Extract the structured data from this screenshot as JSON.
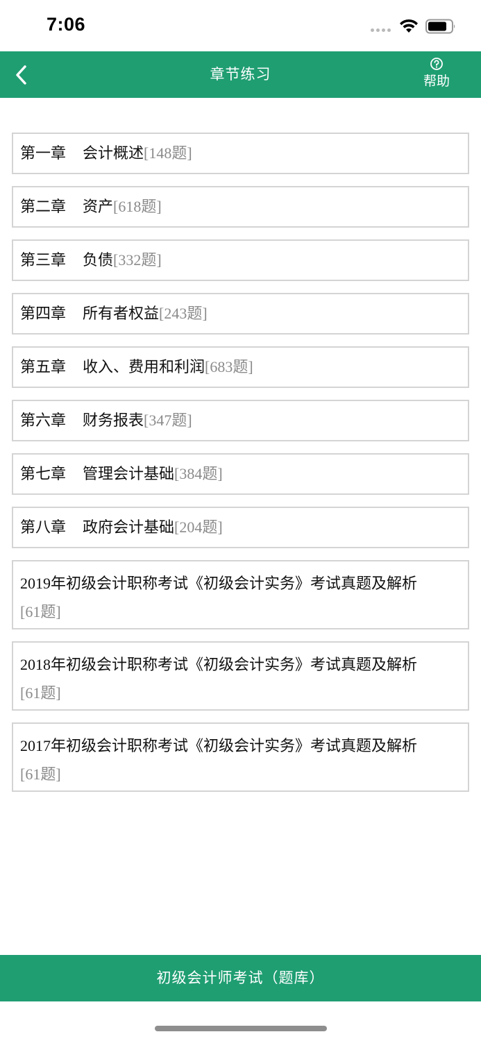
{
  "status": {
    "time": "7:06"
  },
  "header": {
    "title": "章节练习",
    "help_label": "帮助"
  },
  "chapters": [
    {
      "num": "第一章",
      "name": "会计概述",
      "count": "[148题]"
    },
    {
      "num": "第二章",
      "name": "资产",
      "count": "[618题]"
    },
    {
      "num": "第三章",
      "name": "负债",
      "count": "[332题]"
    },
    {
      "num": "第四章",
      "name": "所有者权益",
      "count": "[243题]"
    },
    {
      "num": "第五章",
      "name": "收入、费用和利润",
      "count": "[683题]"
    },
    {
      "num": "第六章",
      "name": "财务报表",
      "count": "[347题]"
    },
    {
      "num": "第七章",
      "name": "管理会计基础",
      "count": "[384题]"
    },
    {
      "num": "第八章",
      "name": "政府会计基础",
      "count": "[204题]"
    }
  ],
  "exams": [
    {
      "year": "2019",
      "name": "年初级会计职称考试《初级会计实务》考试真题及解析",
      "count": "[61题]"
    },
    {
      "year": "2018",
      "name": "年初级会计职称考试《初级会计实务》考试真题及解析",
      "count": "[61题]"
    },
    {
      "year": "2017",
      "name": "年初级会计职称考试《初级会计实务》考试真题及解析",
      "count": "[61题]"
    }
  ],
  "footer": {
    "label": "初级会计师考试（题库）"
  },
  "colors": {
    "accent": "#1f9e72",
    "count_gray": "#8a8a8a",
    "border": "#d4d4d4"
  }
}
